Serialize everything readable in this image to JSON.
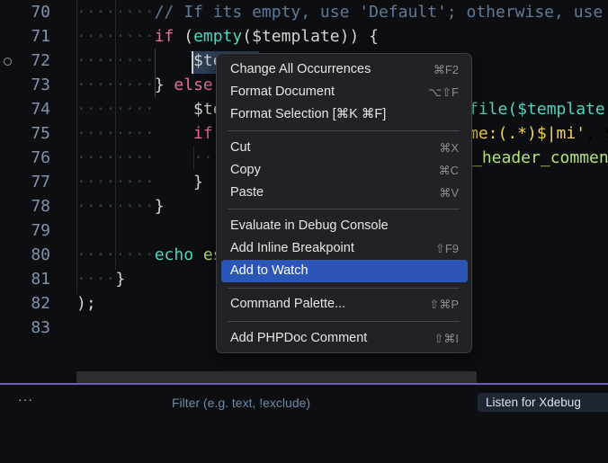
{
  "editor": {
    "line_numbers": [
      "70",
      "71",
      "72",
      "73",
      "74",
      "75",
      "76",
      "77",
      "78",
      "79",
      "80",
      "81",
      "82",
      "83"
    ],
    "lines": {
      "l70": {
        "indent": "········",
        "text": "// If its empty, use 'Default'; otherwise, use"
      },
      "l71": {
        "indent": "········",
        "kw": "if",
        "p1": " (",
        "fn": "empty",
        "p2": "($template)) {"
      },
      "l72": {
        "indent": "········    ",
        "text": "$te"
      },
      "l73": {
        "indent": "········",
        "p1": "} ",
        "kw": "else"
      },
      "l74": {
        "indent": "········    ",
        "text": "$te",
        "right": "file($template)"
      },
      "l75": {
        "indent": "········    ",
        "kw": "if",
        "right_a": "me:(.*)$|mi'",
        "right_b": ", $"
      },
      "l76": {
        "indent": "········    ····",
        "right": "_header_commen"
      },
      "l77": {
        "indent": "········    ",
        "text": "}"
      },
      "l78": {
        "indent": "········",
        "text": "}"
      },
      "l80": {
        "indent": "········",
        "fn": "echo",
        "st": " es"
      },
      "l81": {
        "indent": "····",
        "text": "}"
      },
      "l82": {
        "indent": "",
        "text": ");"
      }
    }
  },
  "context_menu": {
    "items": [
      {
        "label": "Change All Occurrences",
        "shortcut": "⌘F2"
      },
      {
        "label": "Format Document",
        "shortcut": "⌥⇧F"
      },
      {
        "label": "Format Selection [⌘K ⌘F]",
        "shortcut": ""
      },
      {
        "label": "Cut",
        "shortcut": "⌘X"
      },
      {
        "label": "Copy",
        "shortcut": "⌘C"
      },
      {
        "label": "Paste",
        "shortcut": "⌘V"
      },
      {
        "label": "Evaluate in Debug Console",
        "shortcut": ""
      },
      {
        "label": "Add Inline Breakpoint",
        "shortcut": "⇧F9"
      },
      {
        "label": "Add to Watch",
        "shortcut": ""
      },
      {
        "label": "Command Palette...",
        "shortcut": "⇧⌘P"
      },
      {
        "label": "Add PHPDoc Comment",
        "shortcut": "⇧⌘I"
      }
    ],
    "highlighted": "Add to Watch",
    "highlight_color": "#2b56b8"
  },
  "panel": {
    "more_label": "···",
    "filter_placeholder": "Filter (e.g. text, !exclude)",
    "launch_config": "Listen for Xdebug"
  }
}
